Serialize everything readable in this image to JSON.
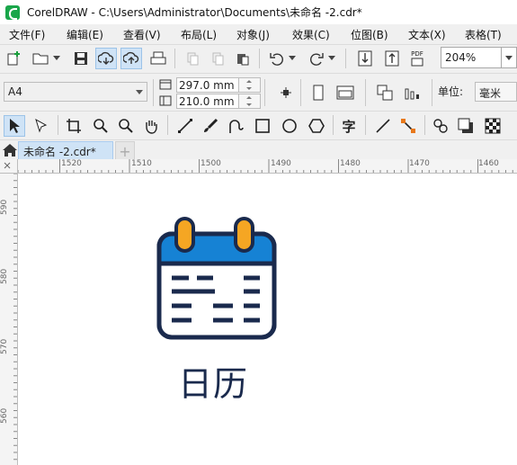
{
  "window": {
    "title": "CorelDRAW - C:\\Users\\Administrator\\Documents\\未命名 -2.cdr*"
  },
  "menu": {
    "items": [
      {
        "label": "文件(F)"
      },
      {
        "label": "编辑(E)"
      },
      {
        "label": "查看(V)"
      },
      {
        "label": "布局(L)"
      },
      {
        "label": "对象(J)"
      },
      {
        "label": "效果(C)"
      },
      {
        "label": "位图(B)"
      },
      {
        "label": "文本(X)"
      },
      {
        "label": "表格(T)"
      }
    ]
  },
  "toolbar": {
    "zoom_value": "204%",
    "pdf_label": "PDF"
  },
  "property_bar": {
    "page_size": "A4",
    "width": "297.0 mm",
    "height": "210.0 mm",
    "unit_label": "单位:",
    "unit_value": "毫米"
  },
  "tools": {
    "text_tool_glyph": "字"
  },
  "tabs": {
    "active_doc": "未命名 -2.cdr*",
    "new_tab_glyph": "+"
  },
  "rulers": {
    "horizontal": [
      "1520",
      "1510",
      "1500",
      "1490",
      "1480",
      "1470",
      "1460"
    ],
    "vertical": [
      "590",
      "580",
      "570",
      "560"
    ]
  },
  "canvas": {
    "icon_label": "日历",
    "colors": {
      "header_blue": "#1682d4",
      "ring_orange": "#f5a623",
      "outline_navy": "#1a2a4d"
    }
  }
}
